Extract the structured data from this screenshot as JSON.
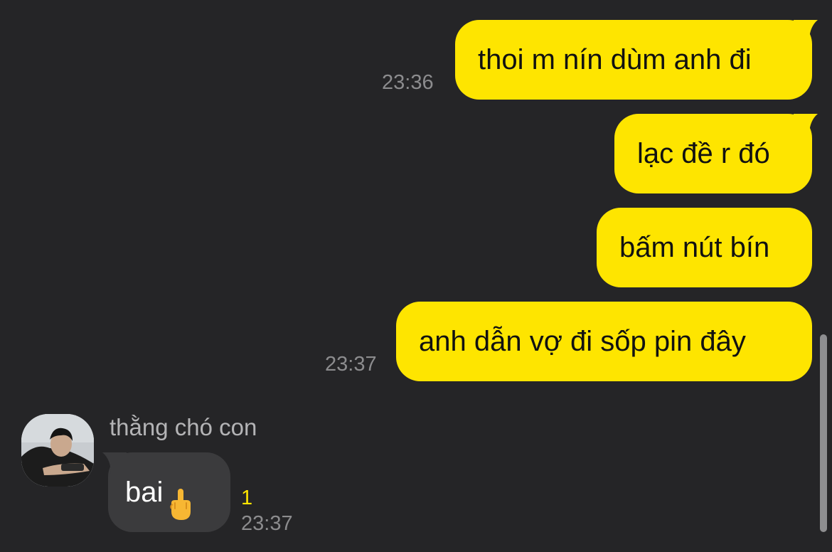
{
  "messages_out": [
    {
      "text": "thoi m nín dùm anh đi",
      "time": "23:36"
    },
    {
      "text": "lạc đề r đó",
      "time": ""
    },
    {
      "text": "bấm nút bín",
      "time": ""
    },
    {
      "text": "anh dẫn vợ đi sốp pin đây",
      "time": "23:37"
    }
  ],
  "incoming": {
    "sender": "thằng chó con",
    "text": "bai",
    "emoji": "middle-finger-emoji",
    "unread_count": "1",
    "time": "23:37"
  },
  "colors": {
    "background": "#252527",
    "outgoing_bubble": "#fee500",
    "incoming_bubble": "#3b3b3d",
    "unread": "#fee500",
    "time": "#8c8c8e"
  }
}
